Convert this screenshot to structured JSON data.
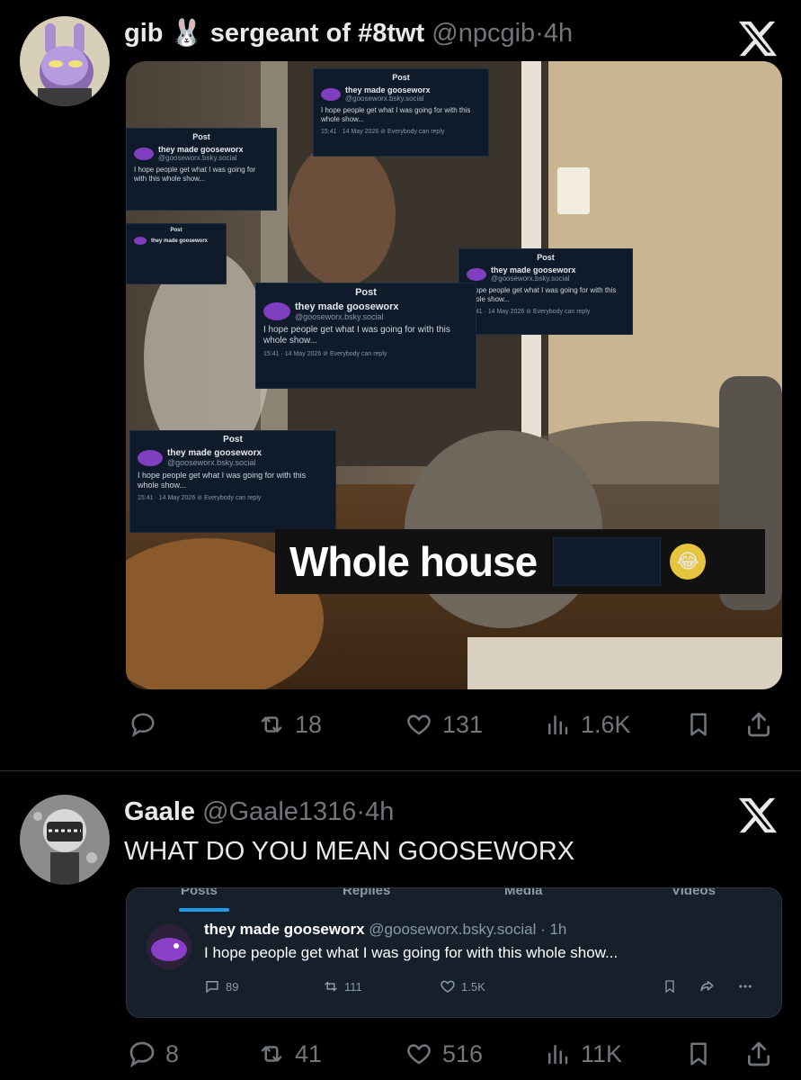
{
  "tweets": [
    {
      "display_name": "gib 🐰 sergeant of #8twt",
      "handle": "@npcgib",
      "separator": "·",
      "time": "4h",
      "media": {
        "caption": "Whole house",
        "overlay_post": {
          "title": "Post",
          "name": "they made gooseworx",
          "handle": "@gooseworx.bsky.social",
          "text": "I hope people get what I was going for with this whole show...",
          "footer": "15:41 · 14 May 2026  ⊘ Everybody can reply"
        }
      },
      "actions": {
        "replies": "",
        "reposts": "18",
        "likes": "131",
        "views": "1.6K"
      }
    },
    {
      "display_name": "Gaale",
      "handle": "@Gaale1316",
      "separator": "·",
      "time": "4h",
      "text": "WHAT DO YOU MEAN GOOSEWORX",
      "quoted_screenshot": {
        "tabs": [
          "Posts",
          "Replies",
          "Media",
          "Videos"
        ],
        "name": "they made gooseworx",
        "handle": "@gooseworx.bsky.social · 1h",
        "text": "I hope people get what I was going for with this whole show...",
        "replies": "89",
        "reposts": "111",
        "likes": "1.5K"
      },
      "actions": {
        "replies": "8",
        "reposts": "41",
        "likes": "516",
        "views": "11K"
      }
    }
  ],
  "colors": {
    "background": "#000000",
    "text": "#e7e9ea",
    "muted": "#71767b",
    "accent": "#1d9bf0"
  }
}
